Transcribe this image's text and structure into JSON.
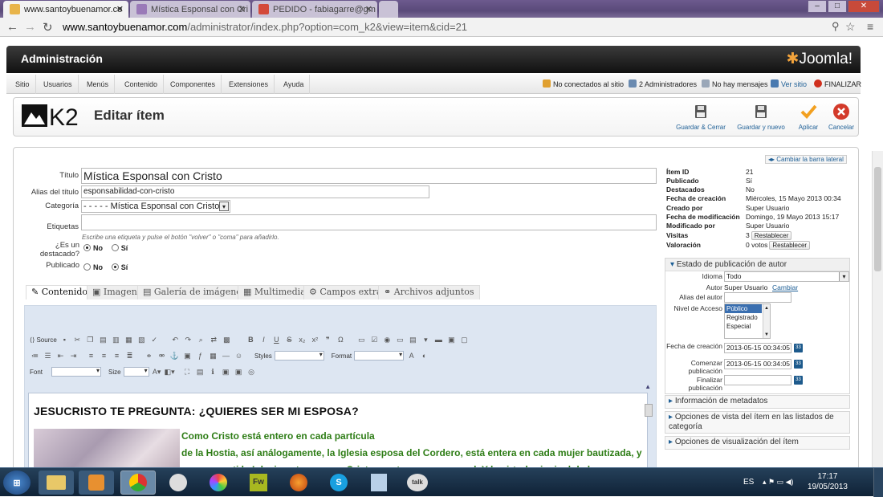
{
  "browser": {
    "tabs": [
      {
        "title": "www.santoybuenamor.co",
        "active": true
      },
      {
        "title": "Mística Esponsal con Cri",
        "active": false
      },
      {
        "title": "PEDIDO - fabiagarre@gm",
        "active": false
      }
    ],
    "url_domain": "www.santoybuenamor.com",
    "url_path": "/administrator/index.php?option=com_k2&view=item&cid=21"
  },
  "header": {
    "title": "Administración",
    "logo": "Joomla!"
  },
  "menu": [
    "Sitio",
    "Usuarios",
    "Menús",
    "Contenido",
    "Componentes",
    "Extensiones",
    "Ayuda"
  ],
  "status": {
    "not_connected": "No conectados al sitio",
    "admins": "2 Administradores",
    "messages": "No hay mensajes",
    "view_site": "Ver sitio",
    "logout": "FINALIZAR"
  },
  "toolbar": {
    "page_title": "Editar ítem",
    "buttons": [
      "Guardar & Cerrar",
      "Guardar y nuevo",
      "Aplicar",
      "Cancelar"
    ]
  },
  "form": {
    "title_label": "Título",
    "title_value": "Mística Esponsal con Cristo",
    "alias_label": "Alias del título",
    "alias_value": "esponsabilidad-con-cristo",
    "category_label": "Categoría",
    "category_value": "- - - - - Mística Esponsal con Cristo",
    "tags_label": "Etiquetas",
    "tags_help": "Escribe una etiqueta y pulse el botón \"volver\" o \"coma\" para añadirlo.",
    "featured_label": "¿Es un destacado?",
    "published_label": "Publicado",
    "no": "No",
    "yes": "Sí",
    "toggle_sidebar": "Cambiar la barra lateral"
  },
  "editor_tabs": [
    "Contenido",
    "Imagen",
    "Galería de imágenes",
    "Multimedia",
    "Campos extra",
    "Archivos adjuntos"
  ],
  "editor": {
    "source": "Source",
    "styles": "Styles",
    "format": "Format",
    "font": "Font",
    "size": "Size",
    "heading": "JESUCRISTO TE PREGUNTA: ¿QUIERES SER MI ESPOSA?",
    "line1": "Como Cristo está entero en cada partícula",
    "line2": "de la Hostia, así análogamente, la Iglesia esposa del Cordero, está entera en cada mujer bautizada, y",
    "line3": "por eso en ti la Iglesia entera ama a Cristo con tu amor esponsal. Y la virtud principal de la esposa es"
  },
  "info": [
    {
      "label": "Ítem ID",
      "value": "21"
    },
    {
      "label": "Publicado",
      "value": "Sí"
    },
    {
      "label": "Destacados",
      "value": "No"
    },
    {
      "label": "Fecha de creación",
      "value": "Miércoles, 15 Mayo 2013 00:34"
    },
    {
      "label": "Creado por",
      "value": "Super Usuario"
    },
    {
      "label": "Fecha de modificación",
      "value": "Domingo, 19 Mayo 2013 15:17"
    },
    {
      "label": "Modificado por",
      "value": "Super Usuario"
    },
    {
      "label": "Visitas",
      "value": "3"
    },
    {
      "label": "Valoración",
      "value": "0 votos"
    }
  ],
  "reset": "Restablecer",
  "publish_panel": {
    "title": "Estado de publicación de autor",
    "language_label": "Idioma",
    "language_value": "Todo",
    "author_label": "Autor",
    "author_value": "Super Usuario",
    "change": "Cambiar",
    "author_alias_label": "Alias del autor",
    "access_label": "Nivel de Acceso",
    "access_options": [
      "Público",
      "Registrado",
      "Especial"
    ],
    "created_label": "Fecha de creación",
    "created_value": "2013-05-15 00:34:05",
    "start_label": "Comenzar publicación",
    "start_value": "2013-05-15 00:34:05",
    "end_label": "Finalizar publicación"
  },
  "collapsed_panels": [
    "Información de metadatos",
    "Opciones de vista del ítem en las listados de categoría",
    "Opciones de visualización del ítem"
  ],
  "taskbar": {
    "lang": "ES",
    "time": "17:17",
    "date": "19/05/2013"
  }
}
